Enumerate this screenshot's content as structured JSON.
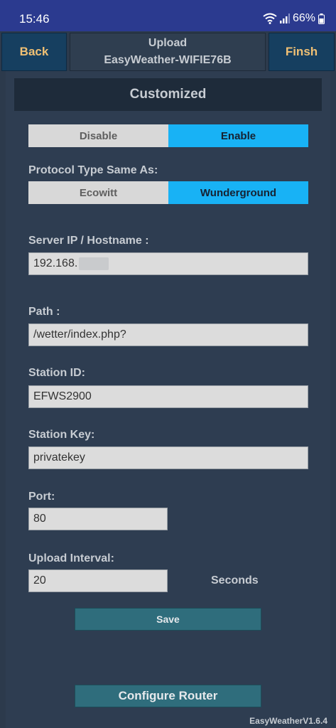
{
  "status_bar": {
    "time": "15:46",
    "battery": "66%"
  },
  "topbar": {
    "back_label": "Back",
    "title_line1": "Upload",
    "title_line2": "EasyWeather-WIFIE76B",
    "finish_label": "Finsh"
  },
  "section": {
    "title": "Customized"
  },
  "toggle": {
    "disable_label": "Disable",
    "enable_label": "Enable",
    "selected": "Enable"
  },
  "protocol": {
    "label": "Protocol Type Same As:",
    "option1": "Ecowitt",
    "option2": "Wunderground",
    "selected": "Wunderground"
  },
  "server": {
    "label": "Server IP / Hostname :",
    "value": "192.168."
  },
  "path": {
    "label": "Path :",
    "value": "/wetter/index.php?"
  },
  "station_id": {
    "label": "Station ID:",
    "value": "EFWS2900"
  },
  "station_key": {
    "label": "Station Key:",
    "value": "privatekey"
  },
  "port": {
    "label": "Port:",
    "value": "80"
  },
  "interval": {
    "label": "Upload Interval:",
    "value": "20",
    "unit": "Seconds"
  },
  "actions": {
    "save_label": "Save",
    "router_label": "Configure Router"
  },
  "footer": {
    "version": "EasyWeatherV1.6.4"
  },
  "colors": {
    "accent": "#18b2f5",
    "button": "#2f6d7c",
    "nav_text": "#f0c074",
    "background": "#2c3a4c"
  }
}
